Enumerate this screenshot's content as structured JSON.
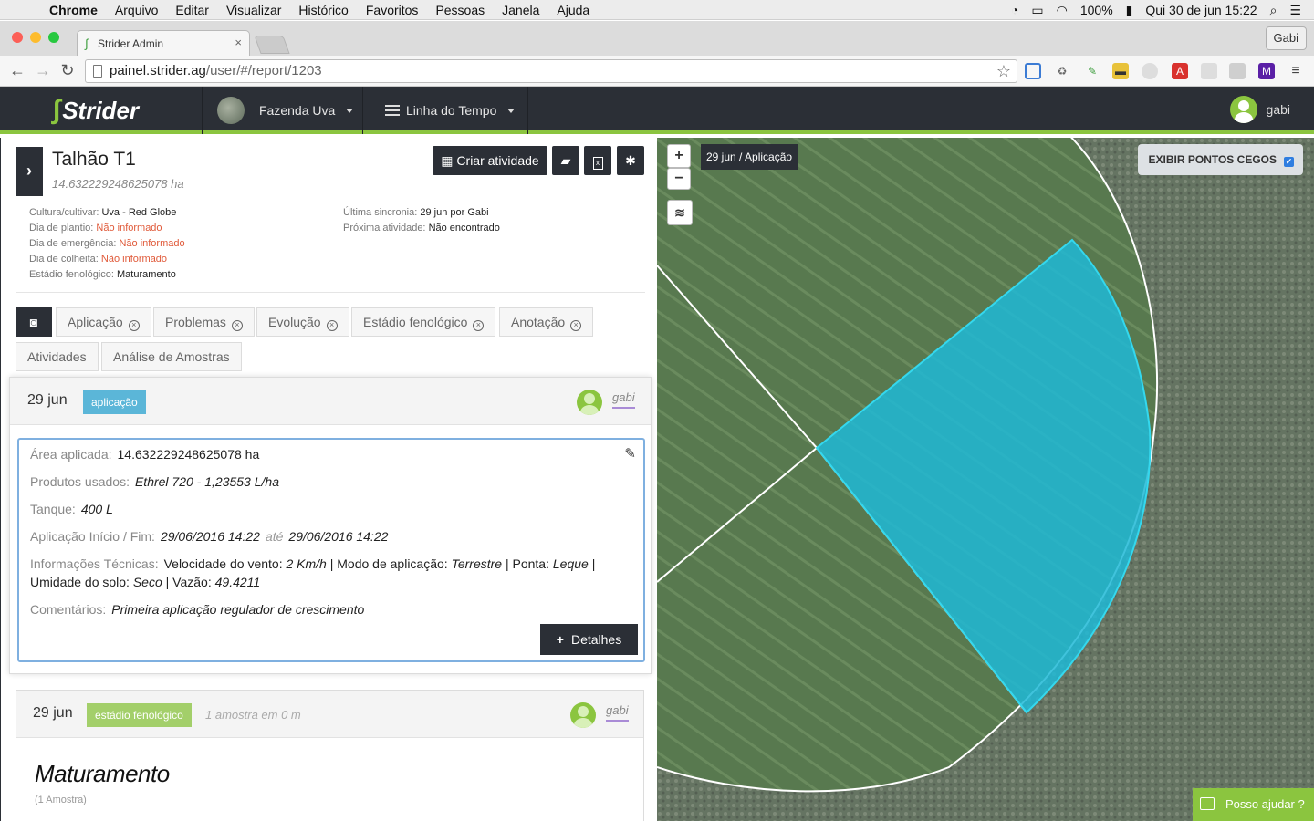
{
  "menubar": {
    "app": "Chrome",
    "items": [
      "Arquivo",
      "Editar",
      "Visualizar",
      "Histórico",
      "Favoritos",
      "Pessoas",
      "Janela",
      "Ajuda"
    ],
    "battery": "100%",
    "clock": "Qui 30 de jun  15:22"
  },
  "browser": {
    "tab_title": "Strider Admin",
    "profile": "Gabi",
    "url_host": "painel.strider.ag",
    "url_path": "/user/#/report/1203"
  },
  "header": {
    "logo": "Strider",
    "farm": "Fazenda Uva",
    "view": "Linha do Tempo",
    "user": "gabi",
    "accent": "#8bc53f",
    "bg": "#2b2f36"
  },
  "plot": {
    "title": "Talhão T1",
    "area": "14.632229248625078 ha",
    "create_label": "Criar atividade",
    "info_left": [
      {
        "label": "Cultura/cultivar:",
        "value": "Uva - Red Globe",
        "missing": false
      },
      {
        "label": "Dia de plantio:",
        "value": "Não informado",
        "missing": true
      },
      {
        "label": "Dia de emergência:",
        "value": "Não informado",
        "missing": true
      },
      {
        "label": "Dia de colheita:",
        "value": "Não informado",
        "missing": true
      },
      {
        "label": "Estádio fenológico:",
        "value": "Maturamento",
        "missing": false
      }
    ],
    "info_right": [
      {
        "label": "Última sincronia:",
        "value": "29 jun por Gabi"
      },
      {
        "label": "Próxima atividade:",
        "value": "Não encontrado"
      }
    ]
  },
  "filters": {
    "row1": [
      "Aplicação",
      "Problemas",
      "Evolução",
      "Estádio fenológico",
      "Anotação"
    ],
    "row2": [
      "Atividades",
      "Análise de Amostras"
    ]
  },
  "event1": {
    "date": "29 jun",
    "badge": "aplicação",
    "badge_color": "#5bb6d8",
    "user": "gabi",
    "area_label": "Área aplicada:",
    "area_value": "14.632229248625078 ha",
    "products_label": "Produtos usados:",
    "products_value": "Ethrel 720 - 1,23553 L/ha",
    "tank_label": "Tanque:",
    "tank_value": "400 L",
    "period_label": "Aplicação Início / Fim:",
    "period_start": "29/06/2016 14:22",
    "period_sep": "até",
    "period_end": "29/06/2016 14:22",
    "tech_label": "Informações Técnicas:",
    "tech_line1_a": "Velocidade do vento:",
    "tech_line1_b": "2 Km/h",
    "tech_line1_c": "| Modo de aplicação:",
    "tech_line1_d": "Terrestre",
    "tech_line1_e": "| Ponta:",
    "tech_line1_f": "Leque",
    "tech_line1_g": "|",
    "tech_line2_a": "Umidade do solo:",
    "tech_line2_b": "Seco",
    "tech_line2_c": "| Vazão:",
    "tech_line2_d": "49.4211",
    "comments_label": "Comentários:",
    "comments_value": "Primeira aplicação regulador de crescimento",
    "details_label": "Detalhes"
  },
  "event2": {
    "date": "29 jun",
    "badge": "estádio fenológico",
    "badge_color": "#a3cf6a",
    "summary": "1 amostra em 0 m",
    "user": "gabi",
    "stage": "Maturamento",
    "samples": "(1 Amostra)"
  },
  "map": {
    "label": "29 jun / Aplicação",
    "blind_spots": "EXIBIR PONTOS CEGOS",
    "help": "Posso ajudar ?",
    "highlight_color": "#1fb8d6"
  }
}
